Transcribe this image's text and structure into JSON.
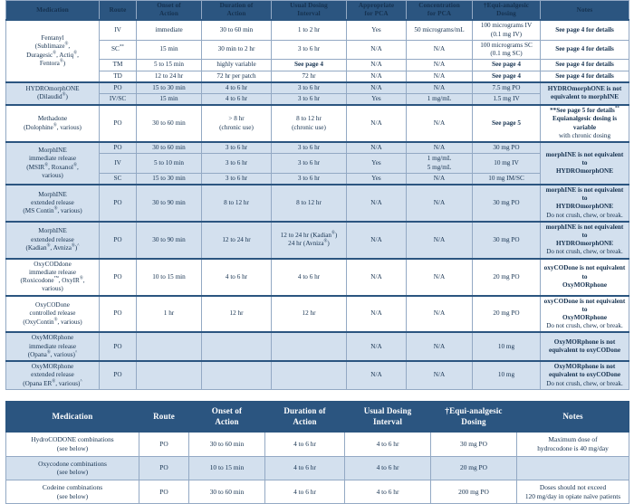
{
  "table1": {
    "headers": [
      "Medication",
      "Route",
      "Onset of Action",
      "Duration of Action",
      "Usual Dosing Interval",
      "Appropriate for PCA",
      "Concentration for PCA",
      "†Equi-analgesic Dosing",
      "Notes"
    ],
    "header_parts": [
      {
        "l1": "Medication",
        "l2": ""
      },
      {
        "l1": "Route",
        "l2": ""
      },
      {
        "l1": "Onset of",
        "l2": "Action"
      },
      {
        "l1": "Duration of",
        "l2": "Action"
      },
      {
        "l1": "Usual Dosing",
        "l2": "Interval"
      },
      {
        "l1": "Appropriate",
        "l2": "for PCA"
      },
      {
        "l1": "Concentration",
        "l2": "for PCA"
      },
      {
        "l1": "†Equi-analgesic",
        "l2": "Dosing"
      },
      {
        "l1": "Notes",
        "l2": ""
      }
    ],
    "groups": [
      {
        "med_name": "Fentanyl",
        "med_brands": "(Sublimaze®, Duragesıc®, Actiq®, Fentora®)",
        "med_lines": [
          "Fentanyl",
          "(Sublimaze®,",
          "Duragesic®, Actiq®,",
          "Fentora®)"
        ],
        "shade": false,
        "rows": [
          {
            "route": "IV",
            "onset": "immediate",
            "duration": "30 to 60 min",
            "interval": "1 to 2 hr",
            "pca": "Yes",
            "conc": "50 micrograms/mL",
            "equi_l1": "100 micrograms IV",
            "equi_l2": "(0.1 mg IV)",
            "equi_bold": false,
            "notes": "See page 4 for details",
            "notes_bold": true
          },
          {
            "route": "SC**",
            "onset": "15 min",
            "duration": "30 min to 2 hr",
            "interval": "3 to 6 hr",
            "pca": "N/A",
            "conc": "N/A",
            "equi_l1": "100 micrograms SC",
            "equi_l2": "(0.1 mg SC)",
            "equi_bold": false,
            "notes": "See page 4 for details",
            "notes_bold": true
          },
          {
            "route": "TM",
            "onset": "5 to 15 min",
            "duration": "highly variable",
            "interval": "See page 4",
            "interval_bold": true,
            "pca": "N/A",
            "conc": "N/A",
            "equi_l1": "See page 4",
            "equi_l2": "",
            "equi_bold": true,
            "notes": "See page 4 for details",
            "notes_bold": true
          },
          {
            "route": "TD",
            "onset": "12 to 24 hr",
            "duration": "72 hr per patch",
            "interval": "72 hr",
            "pca": "N/A",
            "conc": "N/A",
            "equi_l1": "See page 4",
            "equi_l2": "",
            "equi_bold": true,
            "notes": "See page 4 for details",
            "notes_bold": true
          }
        ]
      },
      {
        "med_lines": [
          "HYDROmorphONE",
          "(Dilaudid®)"
        ],
        "shade": true,
        "notes_merged": {
          "l1": "HYDROmorphONE is not",
          "l2": "equivalent to morphINE",
          "bold": true
        },
        "rows": [
          {
            "route": "PO",
            "onset": "15 to 30 min",
            "duration": "4 to 6 hr",
            "interval": "3 to 6 hr",
            "pca": "N/A",
            "conc": "N/A",
            "equi_l1": "7.5 mg PO",
            "equi_l2": "",
            "equi_bold": false
          },
          {
            "route": "IV/SC",
            "onset": "15 min",
            "duration": "4 to 6 hr",
            "interval": "3 to 6 hr",
            "pca": "Yes",
            "conc": "1 mg/mL",
            "equi_l1": "1.5 mg IV",
            "equi_l2": "",
            "equi_bold": false
          }
        ]
      },
      {
        "med_lines": [
          "Methadone",
          "(Dolophine®, various)"
        ],
        "shade": false,
        "rows": [
          {
            "route": "PO",
            "onset": "30 to 60 min",
            "duration_l1": "> 8 hr",
            "duration_l2": "(chronic use)",
            "interval_l1": "8 to 12 hr",
            "interval_l2": "(chronic use)",
            "pca": "N/A",
            "conc": "N/A",
            "equi_l1": "See page 5",
            "equi_l2": "",
            "equi_bold": true,
            "notes_l1": "**See page 5 for details**",
            "notes_l2": "Equianalgesic dosing is variable",
            "notes_l3": "with chronic dosing",
            "notes_bold_first": true
          }
        ]
      },
      {
        "med_lines": [
          "MorphINE",
          "immediate release",
          "(MSIR®, Roxanol®,",
          "various)"
        ],
        "shade": true,
        "notes_merged": {
          "l1": "morphINE is not equivalent to",
          "l2": "HYDROmorphONE",
          "bold": true
        },
        "rows": [
          {
            "route": "PO",
            "onset": "30 to 60 min",
            "duration": "3 to 6 hr",
            "interval": "3 to 6 hr",
            "pca": "N/A",
            "conc": "N/A",
            "equi_l1": "30 mg PO",
            "equi_l2": "",
            "equi_bold": false
          },
          {
            "route": "IV",
            "onset": "5 to 10 min",
            "duration": "3 to 6 hr",
            "interval": "3 to 6 hr",
            "pca": "Yes",
            "conc_l1": "1 mg/mL",
            "conc_l2": "5 mg/mL",
            "equi_l1": "10 mg IV",
            "equi_l2": "",
            "equi_bold": false
          },
          {
            "route": "SC",
            "onset": "15 to 30 min",
            "duration": "3 to 6 hr",
            "interval": "3 to 6 hr",
            "pca": "Yes",
            "conc": "N/A",
            "equi_l1": "10 mg IM/SC",
            "equi_l2": "",
            "equi_bold": false
          }
        ]
      },
      {
        "med_lines": [
          "MorphINE",
          "extended release",
          "(MS Contin®, various)"
        ],
        "shade": true,
        "rows": [
          {
            "route": "PO",
            "onset": "30 to 90 min",
            "duration": "8 to 12 hr",
            "interval": "8 to 12 hr",
            "pca": "N/A",
            "conc": "N/A",
            "equi_l1": "30 mg PO",
            "equi_l2": "",
            "equi_bold": false,
            "notes_l1": "morphINE is not equivalent to",
            "notes_l2": "HYDROmorphONE",
            "notes_l3": "Do not crush, chew, or break.",
            "notes_bold_first": true
          }
        ]
      },
      {
        "med_lines": [
          "MorphINE",
          "extended release",
          "(Kadian®, Avniza®)^"
        ],
        "shade": true,
        "rows": [
          {
            "route": "PO",
            "onset": "30 to 90 min",
            "duration": "12 to 24 hr",
            "interval_l1": "12 to 24 hr (Kadian®)",
            "interval_l2": "24 hr (Avniza®)",
            "pca": "N/A",
            "conc": "N/A",
            "equi_l1": "30 mg PO",
            "equi_l2": "",
            "equi_bold": false,
            "notes_l1": "morphINE is not equivalent to",
            "notes_l2": "HYDROmorphONE",
            "notes_l3": "Do not crush, chew, or break.",
            "notes_bold_first": true
          }
        ]
      },
      {
        "med_lines": [
          "OxyCODdone",
          "immediate release",
          "(Roxicodone™, OxyIR®,",
          "various)"
        ],
        "shade": false,
        "rows": [
          {
            "route": "PO",
            "onset": "10 to 15 min",
            "duration": "4 to 6 hr",
            "interval": "4 to 6 hr",
            "pca": "N/A",
            "conc": "N/A",
            "equi_l1": "20 mg PO",
            "equi_l2": "",
            "equi_bold": false,
            "notes_l1": "oxyCODone is not equivalent to",
            "notes_l2": "OxyMORphone",
            "notes_l3": "",
            "notes_bold_first": true
          }
        ]
      },
      {
        "med_lines": [
          "OxyCODone",
          "controlled release",
          "(OxyContin®, various)"
        ],
        "shade": false,
        "rows": [
          {
            "route": "PO",
            "onset": "1 hr",
            "duration": "12 hr",
            "interval": "12 hr",
            "pca": "N/A",
            "conc": "N/A",
            "equi_l1": "20 mg PO",
            "equi_l2": "",
            "equi_bold": false,
            "notes_l1": "oxyCODone is not equivalent to",
            "notes_l2": "OxyMORphone",
            "notes_l3": "Do not crush, chew, or break.",
            "notes_bold_first": true
          }
        ]
      },
      {
        "med_lines": [
          "OxyMORphone",
          "immediate release",
          "(Opana®, various)^"
        ],
        "shade": true,
        "rows": [
          {
            "route": "PO",
            "onset": "",
            "duration": "",
            "interval": "",
            "pca": "N/A",
            "conc": "N/A",
            "equi_l1": "10 mg",
            "equi_l2": "",
            "equi_bold": false,
            "notes_l1": "OxyMORphone is not",
            "notes_l2": "equivalent to oxyCODone",
            "notes_l3": "",
            "notes_bold_first": true
          }
        ]
      },
      {
        "med_lines": [
          "OxyMORphone",
          "extended release",
          "(Opana ER®, various)^"
        ],
        "shade": true,
        "rows": [
          {
            "route": "PO",
            "onset": "",
            "duration": "",
            "interval": "",
            "pca": "N/A",
            "conc": "N/A",
            "equi_l1": "10 mg",
            "equi_l2": "",
            "equi_bold": false,
            "notes_l1": "OxyMORphone is not",
            "notes_l2": "equivalent to oxyCODone",
            "notes_l3": "Do not crush, chew, or break.",
            "notes_bold_first": true
          }
        ]
      }
    ]
  },
  "table2": {
    "header_parts": [
      {
        "l1": "Medication",
        "l2": ""
      },
      {
        "l1": "Route",
        "l2": ""
      },
      {
        "l1": "Onset of",
        "l2": "Action"
      },
      {
        "l1": "Duration of",
        "l2": "Action"
      },
      {
        "l1": "Usual Dosing",
        "l2": "Interval"
      },
      {
        "l1": "†Equi-analgesic",
        "l2": "Dosing"
      },
      {
        "l1": "Notes",
        "l2": ""
      }
    ],
    "rows": [
      {
        "med_l1": "HydroCODONE combinations",
        "med_l2": "(see below)",
        "route": "PO",
        "onset": "30 to 60 min",
        "duration": "4 to 6 hr",
        "interval": "4 to 6 hr",
        "equi": "30 mg PO",
        "notes_l1": "Maximum dose of",
        "notes_l2": "hydrocodone is 40 mg/day",
        "shade": false
      },
      {
        "med_l1": "Oxycodone combinations",
        "med_l2": "(see below)",
        "route": "PO",
        "onset": "10 to 15 min",
        "duration": "4 to 6 hr",
        "interval": "4 to 6 hr",
        "equi": "20 mg PO",
        "notes_l1": "",
        "notes_l2": "",
        "shade": true
      },
      {
        "med_l1": "Codeine combinations",
        "med_l2": "(see below)",
        "route": "PO",
        "onset": "30 to 60 min",
        "duration": "4 to 6 hr",
        "interval": "4 to 6 hr",
        "equi": "200 mg PO",
        "notes_l1": "Doses should not exceed",
        "notes_l2": "120 mg/day in opiate naïve patients",
        "shade": false
      }
    ]
  },
  "colors": {
    "header_blue": "#2b5580",
    "shade_blue": "#d3e0ee",
    "grid_line": "#93a9c4",
    "text": "#15314f"
  }
}
